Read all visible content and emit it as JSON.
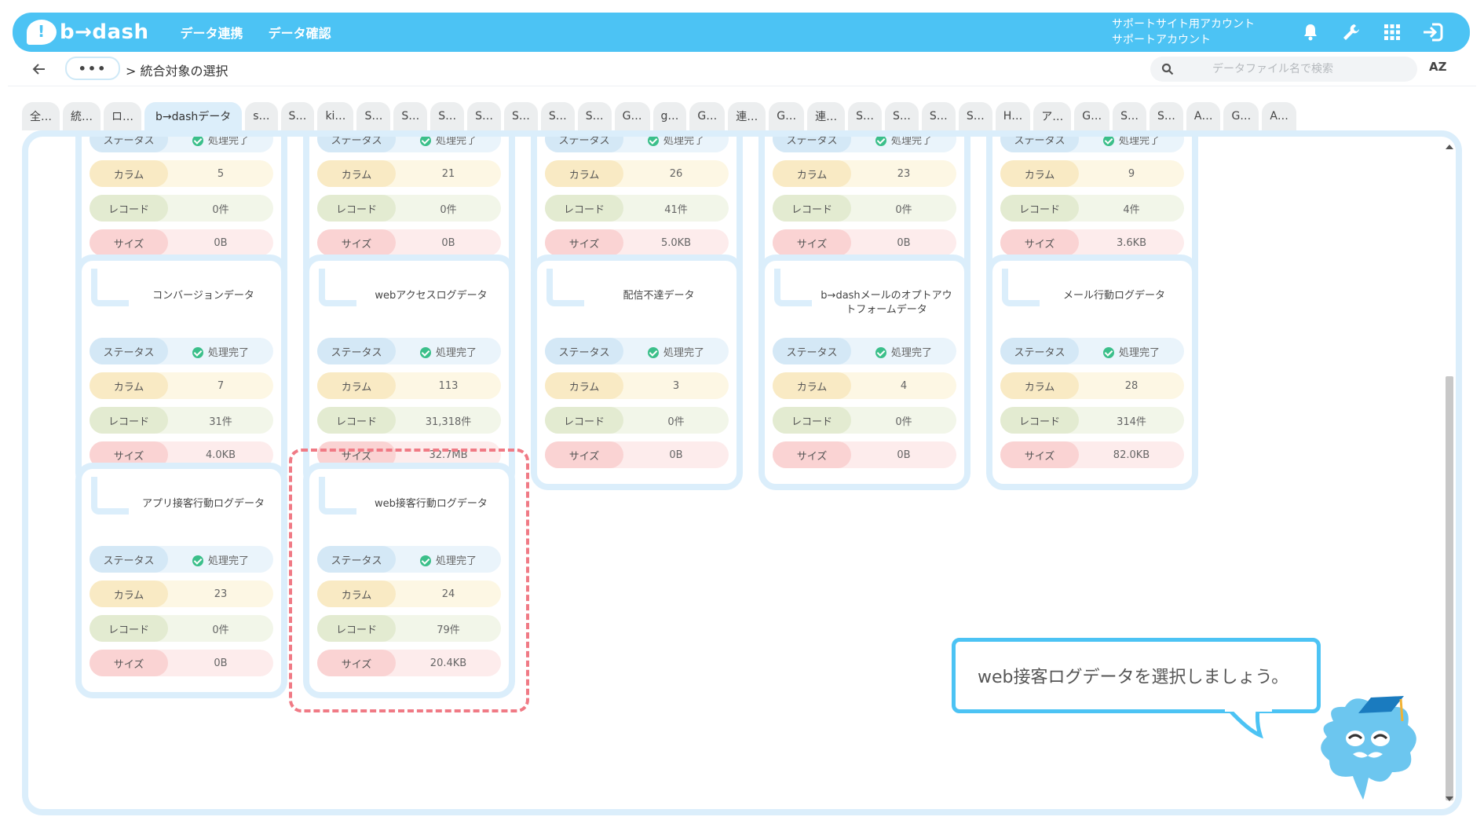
{
  "header": {
    "logo_text": "b→dash",
    "nav": [
      "データ連携",
      "データ確認"
    ],
    "account_line1": "サポートサイト用アカウント",
    "account_line2": "サポートアカウント",
    "icons": [
      "bell-icon",
      "wrench-icon",
      "grid-icon",
      "logout-icon"
    ],
    "brand_color": "#4cc3f4"
  },
  "breadcrumb": {
    "dots": "•••",
    "current": "> 統合対象の選択"
  },
  "search": {
    "placeholder": "データファイル名で検索"
  },
  "sort_label": "AZ",
  "tabs": [
    "全…",
    "統…",
    "ロ…",
    "b→dashデータ",
    "s…",
    "S…",
    "ki…",
    "S…",
    "S…",
    "S…",
    "S…",
    "S…",
    "S…",
    "S…",
    "G…",
    "g…",
    "G…",
    "連…",
    "G…",
    "連…",
    "S…",
    "S…",
    "S…",
    "S…",
    "H…",
    "ア…",
    "G…",
    "S…",
    "S…",
    "A…",
    "G…",
    "A…"
  ],
  "active_tab": "b→dashデータ",
  "labels": {
    "status": "ステータス",
    "column": "カラム",
    "record": "レコード",
    "size": "サイズ"
  },
  "top_cards": [
    {
      "status": "処理完了",
      "column": "5",
      "record": "0件",
      "size": "0B"
    },
    {
      "status": "処理完了",
      "column": "21",
      "record": "0件",
      "size": "0B"
    },
    {
      "status": "処理完了",
      "column": "26",
      "record": "41件",
      "size": "5.0KB"
    },
    {
      "status": "処理完了",
      "column": "23",
      "record": "0件",
      "size": "0B"
    },
    {
      "status": "処理完了",
      "column": "9",
      "record": "4件",
      "size": "3.6KB"
    }
  ],
  "cards": [
    {
      "title": "コンバージョンデータ",
      "status": "処理完了",
      "column": "7",
      "record": "31件",
      "size": "4.0KB"
    },
    {
      "title": "webアクセスログデータ",
      "status": "処理完了",
      "column": "113",
      "record": "31,318件",
      "size": "32.7MB"
    },
    {
      "title": "配信不達データ",
      "status": "処理完了",
      "column": "3",
      "record": "0件",
      "size": "0B"
    },
    {
      "title": "b→dashメールのオプトアウトフォームデータ",
      "status": "処理完了",
      "column": "4",
      "record": "0件",
      "size": "0B"
    },
    {
      "title": "メール行動ログデータ",
      "status": "処理完了",
      "column": "28",
      "record": "314件",
      "size": "82.0KB"
    },
    {
      "title": "アプリ接客行動ログデータ",
      "status": "処理完了",
      "column": "23",
      "record": "0件",
      "size": "0B"
    },
    {
      "title": "web接客行動ログデータ",
      "status": "処理完了",
      "column": "24",
      "record": "79件",
      "size": "20.4KB"
    }
  ],
  "highlighted_card": "web接客行動ログデータ",
  "guide_message": "web接客ログデータを選択しましょう。"
}
